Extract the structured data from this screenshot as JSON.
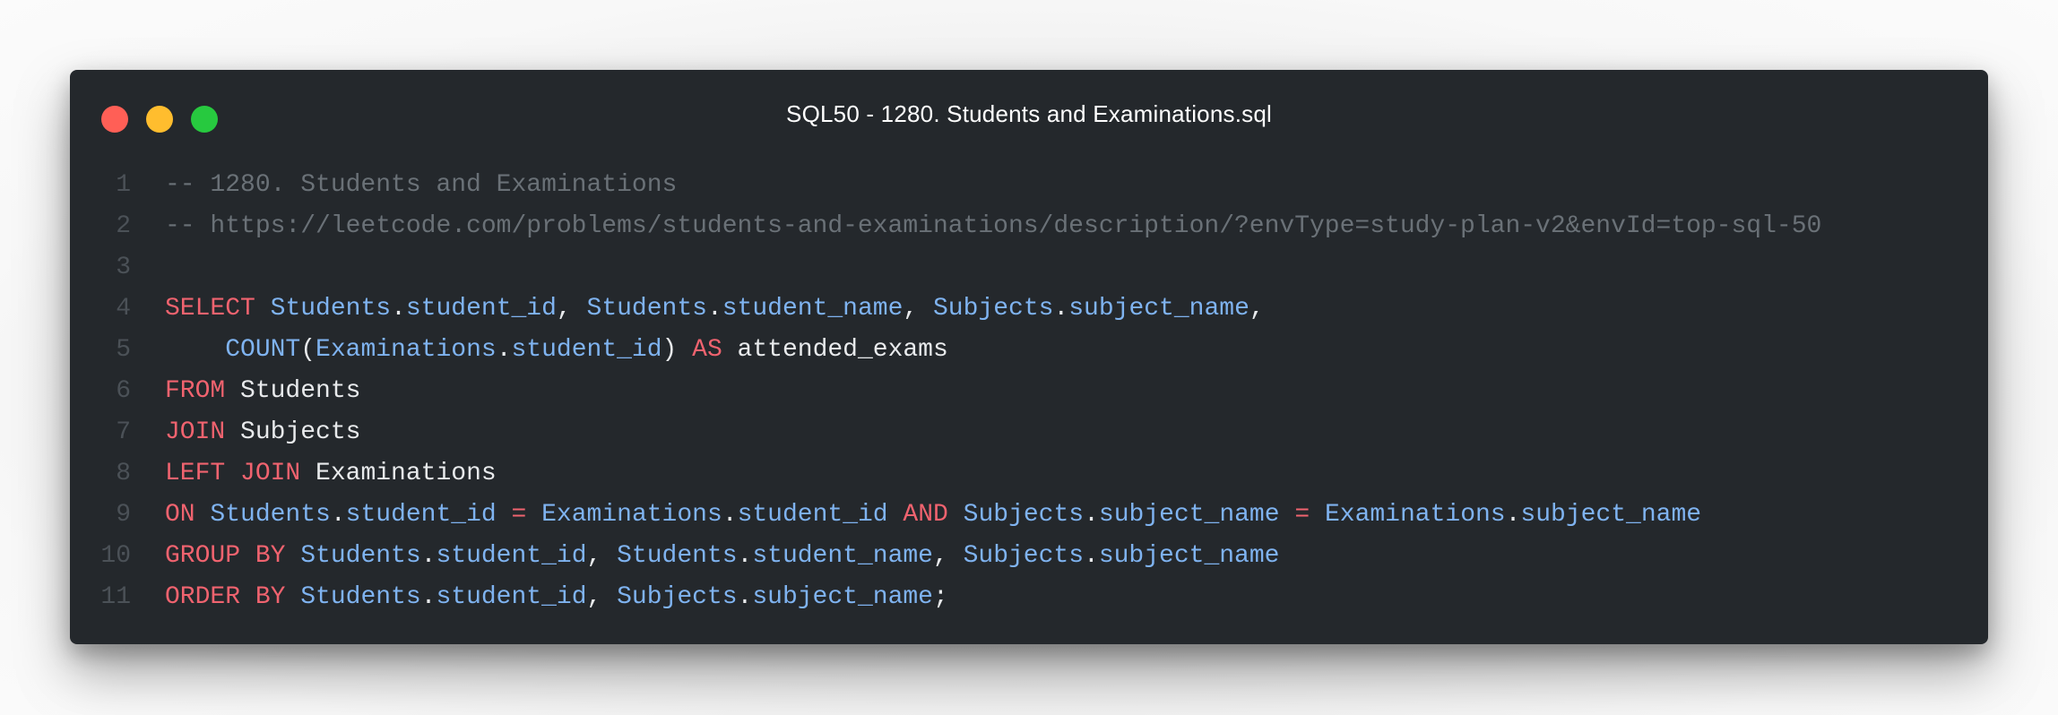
{
  "window": {
    "title": "SQL50 - 1280. Students and Examinations.sql",
    "controls": [
      "close",
      "minimize",
      "maximize"
    ],
    "colors": {
      "background": "#24282c",
      "close": "#ff5f56",
      "minimize": "#ffbd2e",
      "maximize": "#27c93f",
      "comment": "#6a7177",
      "keyword": "#f0636f",
      "identifier": "#7fb3f0",
      "plain": "#e8eaec"
    }
  },
  "lines": [
    {
      "num": "1",
      "tokens": [
        {
          "t": "-- 1280. Students and Examinations",
          "k": "cmt"
        }
      ]
    },
    {
      "num": "2",
      "tokens": [
        {
          "t": "-- https://leetcode.com/problems/students-and-examinations/description/?envType=study-plan-v2&envId=top-sql-50",
          "k": "cmt"
        }
      ]
    },
    {
      "num": "3",
      "tokens": []
    },
    {
      "num": "4",
      "tokens": [
        {
          "t": "SELECT",
          "k": "kw"
        },
        {
          "t": " ",
          "k": "pl"
        },
        {
          "t": "Students",
          "k": "id"
        },
        {
          "t": ".",
          "k": "pl"
        },
        {
          "t": "student_id",
          "k": "id"
        },
        {
          "t": ", ",
          "k": "pl"
        },
        {
          "t": "Students",
          "k": "id"
        },
        {
          "t": ".",
          "k": "pl"
        },
        {
          "t": "student_name",
          "k": "id"
        },
        {
          "t": ", ",
          "k": "pl"
        },
        {
          "t": "Subjects",
          "k": "id"
        },
        {
          "t": ".",
          "k": "pl"
        },
        {
          "t": "subject_name",
          "k": "id"
        },
        {
          "t": ",",
          "k": "pl"
        }
      ]
    },
    {
      "num": "5",
      "tokens": [
        {
          "t": "    ",
          "k": "pl"
        },
        {
          "t": "COUNT",
          "k": "id"
        },
        {
          "t": "(",
          "k": "pl"
        },
        {
          "t": "Examinations",
          "k": "id"
        },
        {
          "t": ".",
          "k": "pl"
        },
        {
          "t": "student_id",
          "k": "id"
        },
        {
          "t": ") ",
          "k": "pl"
        },
        {
          "t": "AS",
          "k": "kw"
        },
        {
          "t": " attended_exams",
          "k": "pl"
        }
      ]
    },
    {
      "num": "6",
      "tokens": [
        {
          "t": "FROM",
          "k": "kw"
        },
        {
          "t": " Students",
          "k": "pl"
        }
      ]
    },
    {
      "num": "7",
      "tokens": [
        {
          "t": "JOIN",
          "k": "kw"
        },
        {
          "t": " Subjects",
          "k": "pl"
        }
      ]
    },
    {
      "num": "8",
      "tokens": [
        {
          "t": "LEFT JOIN",
          "k": "kw"
        },
        {
          "t": " Examinations",
          "k": "pl"
        }
      ]
    },
    {
      "num": "9",
      "tokens": [
        {
          "t": "ON",
          "k": "kw"
        },
        {
          "t": " ",
          "k": "pl"
        },
        {
          "t": "Students",
          "k": "id"
        },
        {
          "t": ".",
          "k": "pl"
        },
        {
          "t": "student_id",
          "k": "id"
        },
        {
          "t": " ",
          "k": "pl"
        },
        {
          "t": "=",
          "k": "kw"
        },
        {
          "t": " ",
          "k": "pl"
        },
        {
          "t": "Examinations",
          "k": "id"
        },
        {
          "t": ".",
          "k": "pl"
        },
        {
          "t": "student_id",
          "k": "id"
        },
        {
          "t": " ",
          "k": "pl"
        },
        {
          "t": "AND",
          "k": "kw"
        },
        {
          "t": " ",
          "k": "pl"
        },
        {
          "t": "Subjects",
          "k": "id"
        },
        {
          "t": ".",
          "k": "pl"
        },
        {
          "t": "subject_name",
          "k": "id"
        },
        {
          "t": " ",
          "k": "pl"
        },
        {
          "t": "=",
          "k": "kw"
        },
        {
          "t": " ",
          "k": "pl"
        },
        {
          "t": "Examinations",
          "k": "id"
        },
        {
          "t": ".",
          "k": "pl"
        },
        {
          "t": "subject_name",
          "k": "id"
        }
      ]
    },
    {
      "num": "10",
      "tokens": [
        {
          "t": "GROUP BY",
          "k": "kw"
        },
        {
          "t": " ",
          "k": "pl"
        },
        {
          "t": "Students",
          "k": "id"
        },
        {
          "t": ".",
          "k": "pl"
        },
        {
          "t": "student_id",
          "k": "id"
        },
        {
          "t": ", ",
          "k": "pl"
        },
        {
          "t": "Students",
          "k": "id"
        },
        {
          "t": ".",
          "k": "pl"
        },
        {
          "t": "student_name",
          "k": "id"
        },
        {
          "t": ", ",
          "k": "pl"
        },
        {
          "t": "Subjects",
          "k": "id"
        },
        {
          "t": ".",
          "k": "pl"
        },
        {
          "t": "subject_name",
          "k": "id"
        }
      ]
    },
    {
      "num": "11",
      "tokens": [
        {
          "t": "ORDER BY",
          "k": "kw"
        },
        {
          "t": " ",
          "k": "pl"
        },
        {
          "t": "Students",
          "k": "id"
        },
        {
          "t": ".",
          "k": "pl"
        },
        {
          "t": "student_id",
          "k": "id"
        },
        {
          "t": ", ",
          "k": "pl"
        },
        {
          "t": "Subjects",
          "k": "id"
        },
        {
          "t": ".",
          "k": "pl"
        },
        {
          "t": "subject_name",
          "k": "id"
        },
        {
          "t": ";",
          "k": "pl"
        }
      ]
    }
  ]
}
